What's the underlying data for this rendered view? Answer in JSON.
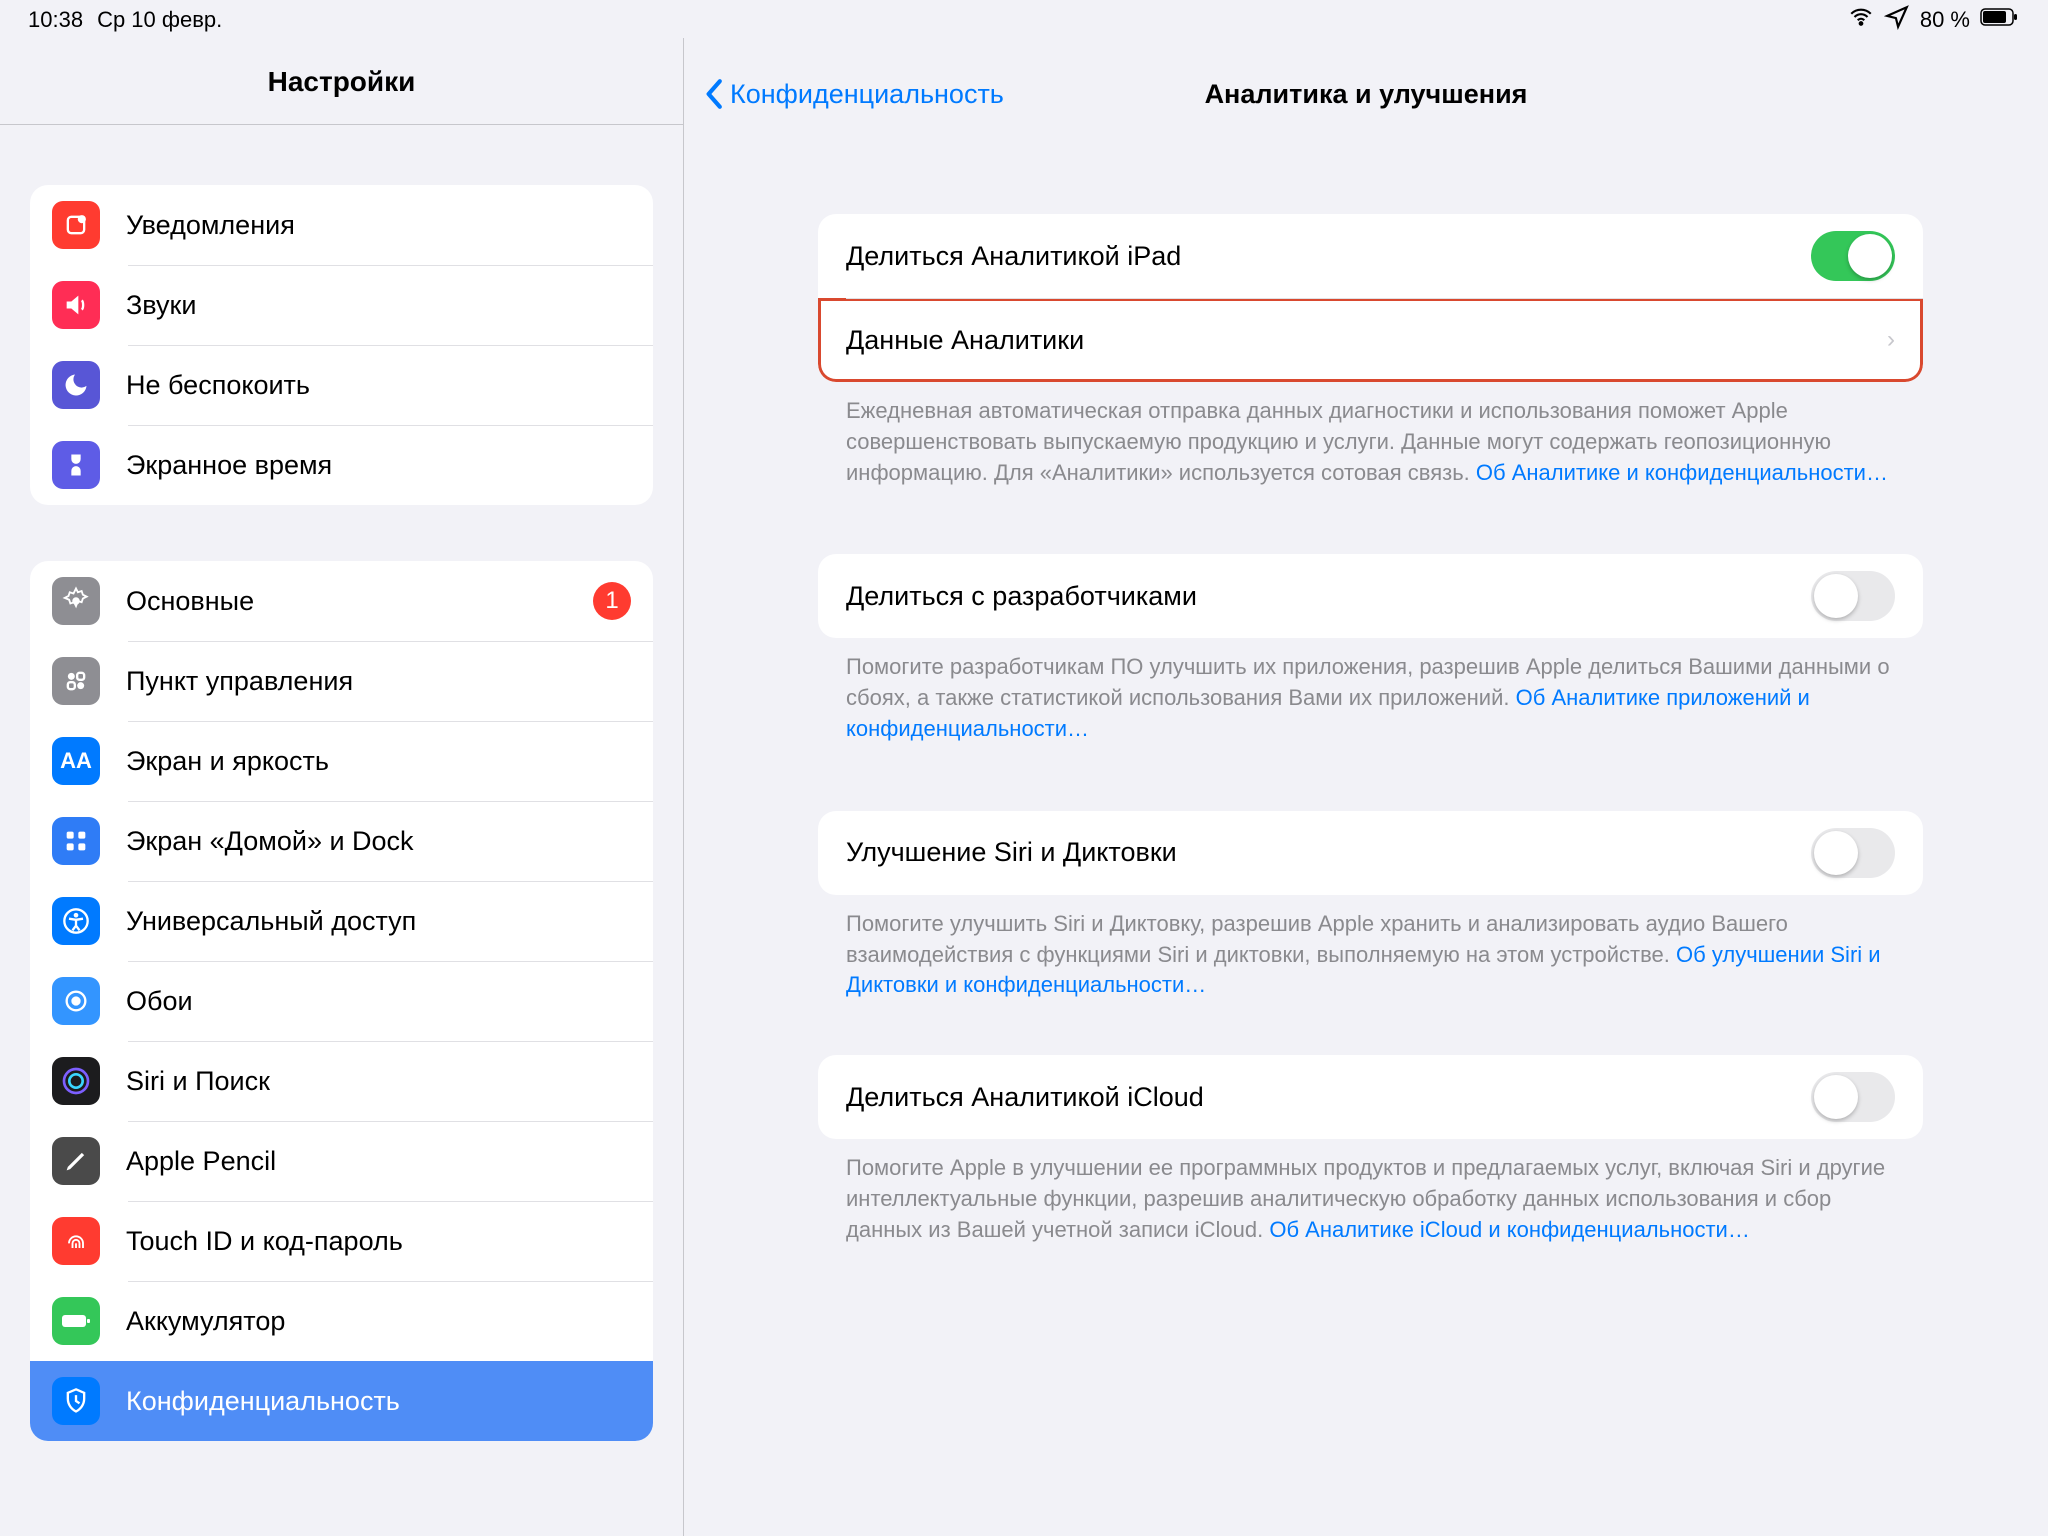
{
  "status": {
    "time": "10:38",
    "date": "Ср 10 февр.",
    "battery_pct": "80 %"
  },
  "sidebar": {
    "title": "Настройки",
    "group1": [
      {
        "label": "Уведомления",
        "icon": "notifications-icon",
        "bg": "bg-red"
      },
      {
        "label": "Звуки",
        "icon": "sounds-icon",
        "bg": "bg-red2"
      },
      {
        "label": "Не беспокоить",
        "icon": "do-not-disturb-icon",
        "bg": "bg-purple"
      },
      {
        "label": "Экранное время",
        "icon": "screen-time-icon",
        "bg": "bg-purple2"
      }
    ],
    "group2": [
      {
        "label": "Основные",
        "icon": "general-icon",
        "bg": "bg-gray",
        "badge": "1"
      },
      {
        "label": "Пункт управления",
        "icon": "control-center-icon",
        "bg": "bg-gray"
      },
      {
        "label": "Экран и яркость",
        "icon": "display-icon",
        "bg": "bg-blue"
      },
      {
        "label": "Экран «Домой» и Dock",
        "icon": "home-screen-icon",
        "bg": "bg-blue2"
      },
      {
        "label": "Универсальный доступ",
        "icon": "accessibility-icon",
        "bg": "bg-blue"
      },
      {
        "label": "Обои",
        "icon": "wallpaper-icon",
        "bg": "bg-cyan"
      },
      {
        "label": "Siri и Поиск",
        "icon": "siri-icon",
        "bg": "bg-dark"
      },
      {
        "label": "Apple Pencil",
        "icon": "pencil-icon",
        "bg": "bg-pencil"
      },
      {
        "label": "Touch ID и код-пароль",
        "icon": "touchid-icon",
        "bg": "bg-red"
      },
      {
        "label": "Аккумулятор",
        "icon": "battery-icon",
        "bg": "bg-green"
      },
      {
        "label": "Конфиденциальность",
        "icon": "privacy-icon",
        "bg": "bg-blue",
        "selected": true
      }
    ]
  },
  "detail": {
    "back": "Конфиденциальность",
    "title": "Аналитика и улучшения",
    "sections": {
      "s1": {
        "row1": "Делиться Аналитикой iPad",
        "row2": "Данные Аналитики",
        "footer": "Ежедневная автоматическая отправка данных диагностики и использования поможет Apple совершенствовать выпускаемую продукцию и услуги. Данные могут содержать геопозиционную информацию. Для «Аналитики» используется сотовая связь.",
        "link": "Об Аналитике и конфиденциальности…"
      },
      "s2": {
        "row1": "Делиться с разработчиками",
        "footer": "Помогите разработчикам ПО улучшить их приложения, разрешив Apple делиться Вашими данными о сбоях, а также статистикой использования Вами их приложений.",
        "link": "Об Аналитике приложений и конфиденциальности…"
      },
      "s3": {
        "row1": "Улучшение Siri и Диктовки",
        "footer": "Помогите улучшить Siri и Диктовку, разрешив Apple хранить и анализировать аудио Вашего взаимодействия с функциями Siri и диктовки, выполняемую на этом устройстве. ",
        "link": "Об улучшении Siri и Диктовки и конфиденциальности…"
      },
      "s4": {
        "row1": "Делиться Аналитикой iCloud",
        "footer": "Помогите Apple в улучшении ее программных продуктов и предлагаемых услуг, включая Siri и другие интеллектуальные функции, разрешив аналитическую обработку данных использования и сбор данных из Вашей учетной записи iCloud. ",
        "link": "Об Аналитике iCloud и конфиденциальности…"
      }
    }
  }
}
